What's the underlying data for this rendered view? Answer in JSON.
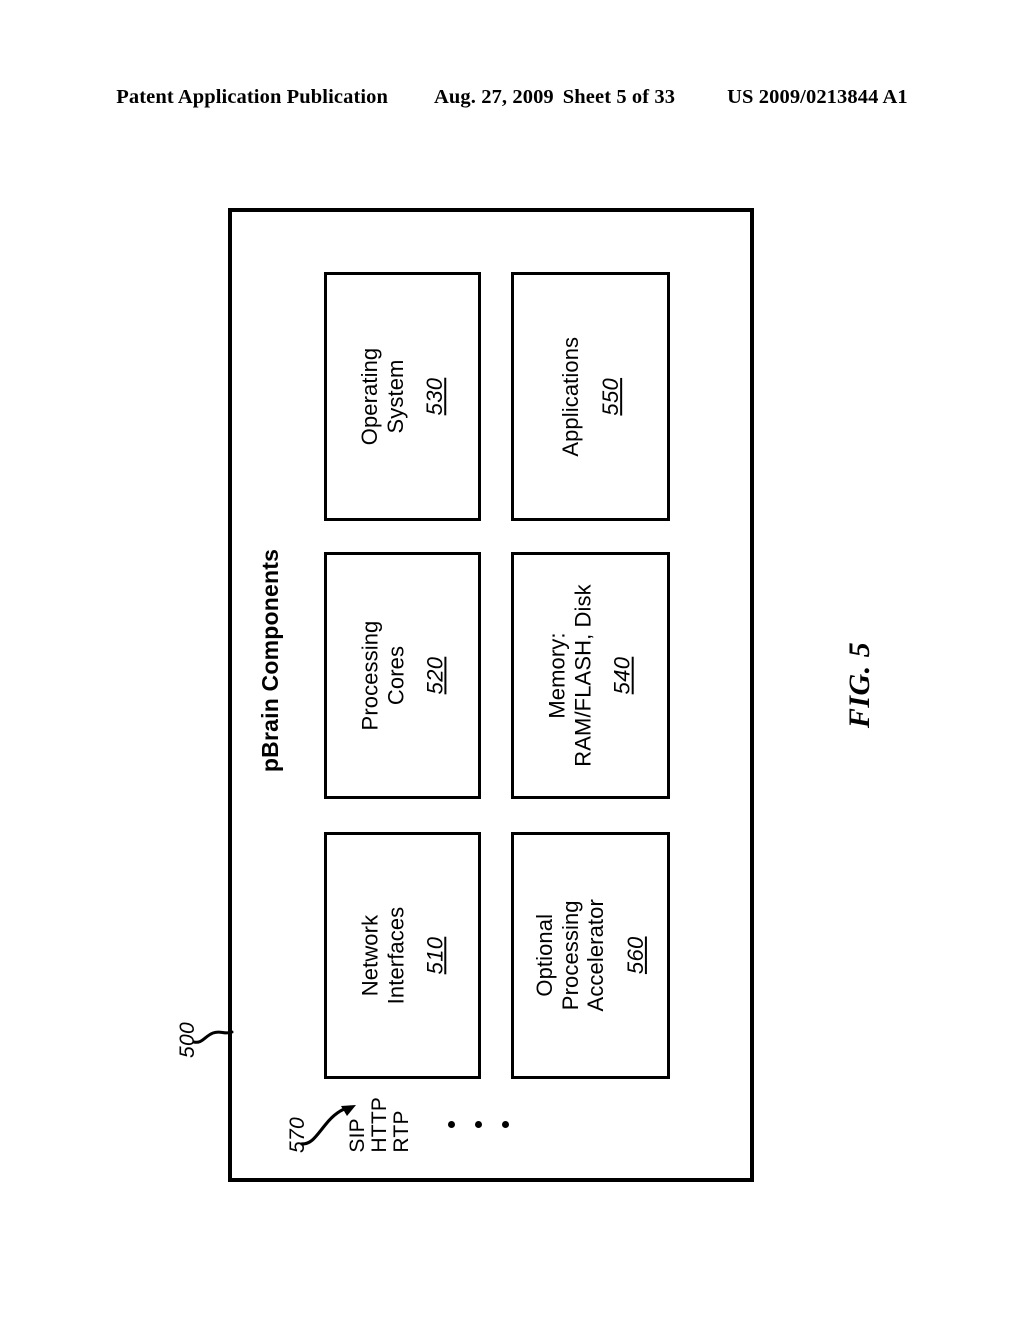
{
  "header": {
    "publication": "Patent Application Publication",
    "date": "Aug. 27, 2009",
    "sheet": "Sheet 5 of 33",
    "patent_number": "US 2009/0213844 A1"
  },
  "figure": {
    "caption": "FIG. 5",
    "diagram_title": "pBrain Components",
    "system_ref": "500",
    "protocols_ref": "570",
    "protocols": [
      "SIP",
      "HTTP",
      "RTP"
    ],
    "protocols_ellipsis": "• • •",
    "components": [
      {
        "id": "os",
        "label_line1": "Operating",
        "label_line2": "System",
        "label_line3": "",
        "numeral": "530"
      },
      {
        "id": "apps",
        "label_line1": "Applications",
        "label_line2": "",
        "label_line3": "",
        "numeral": "550"
      },
      {
        "id": "cores",
        "label_line1": "Processing",
        "label_line2": "Cores",
        "label_line3": "",
        "numeral": "520"
      },
      {
        "id": "mem",
        "label_line1": "Memory:",
        "label_line2": "RAM/FLASH, Disk",
        "label_line3": "",
        "numeral": "540"
      },
      {
        "id": "net",
        "label_line1": "Network",
        "label_line2": "Interfaces",
        "label_line3": "",
        "numeral": "510"
      },
      {
        "id": "accel",
        "label_line1": "Optional",
        "label_line2": "Processing",
        "label_line3": "Accelerator",
        "numeral": "560"
      }
    ]
  },
  "colors": {
    "ink": "#000000",
    "paper": "#ffffff"
  }
}
